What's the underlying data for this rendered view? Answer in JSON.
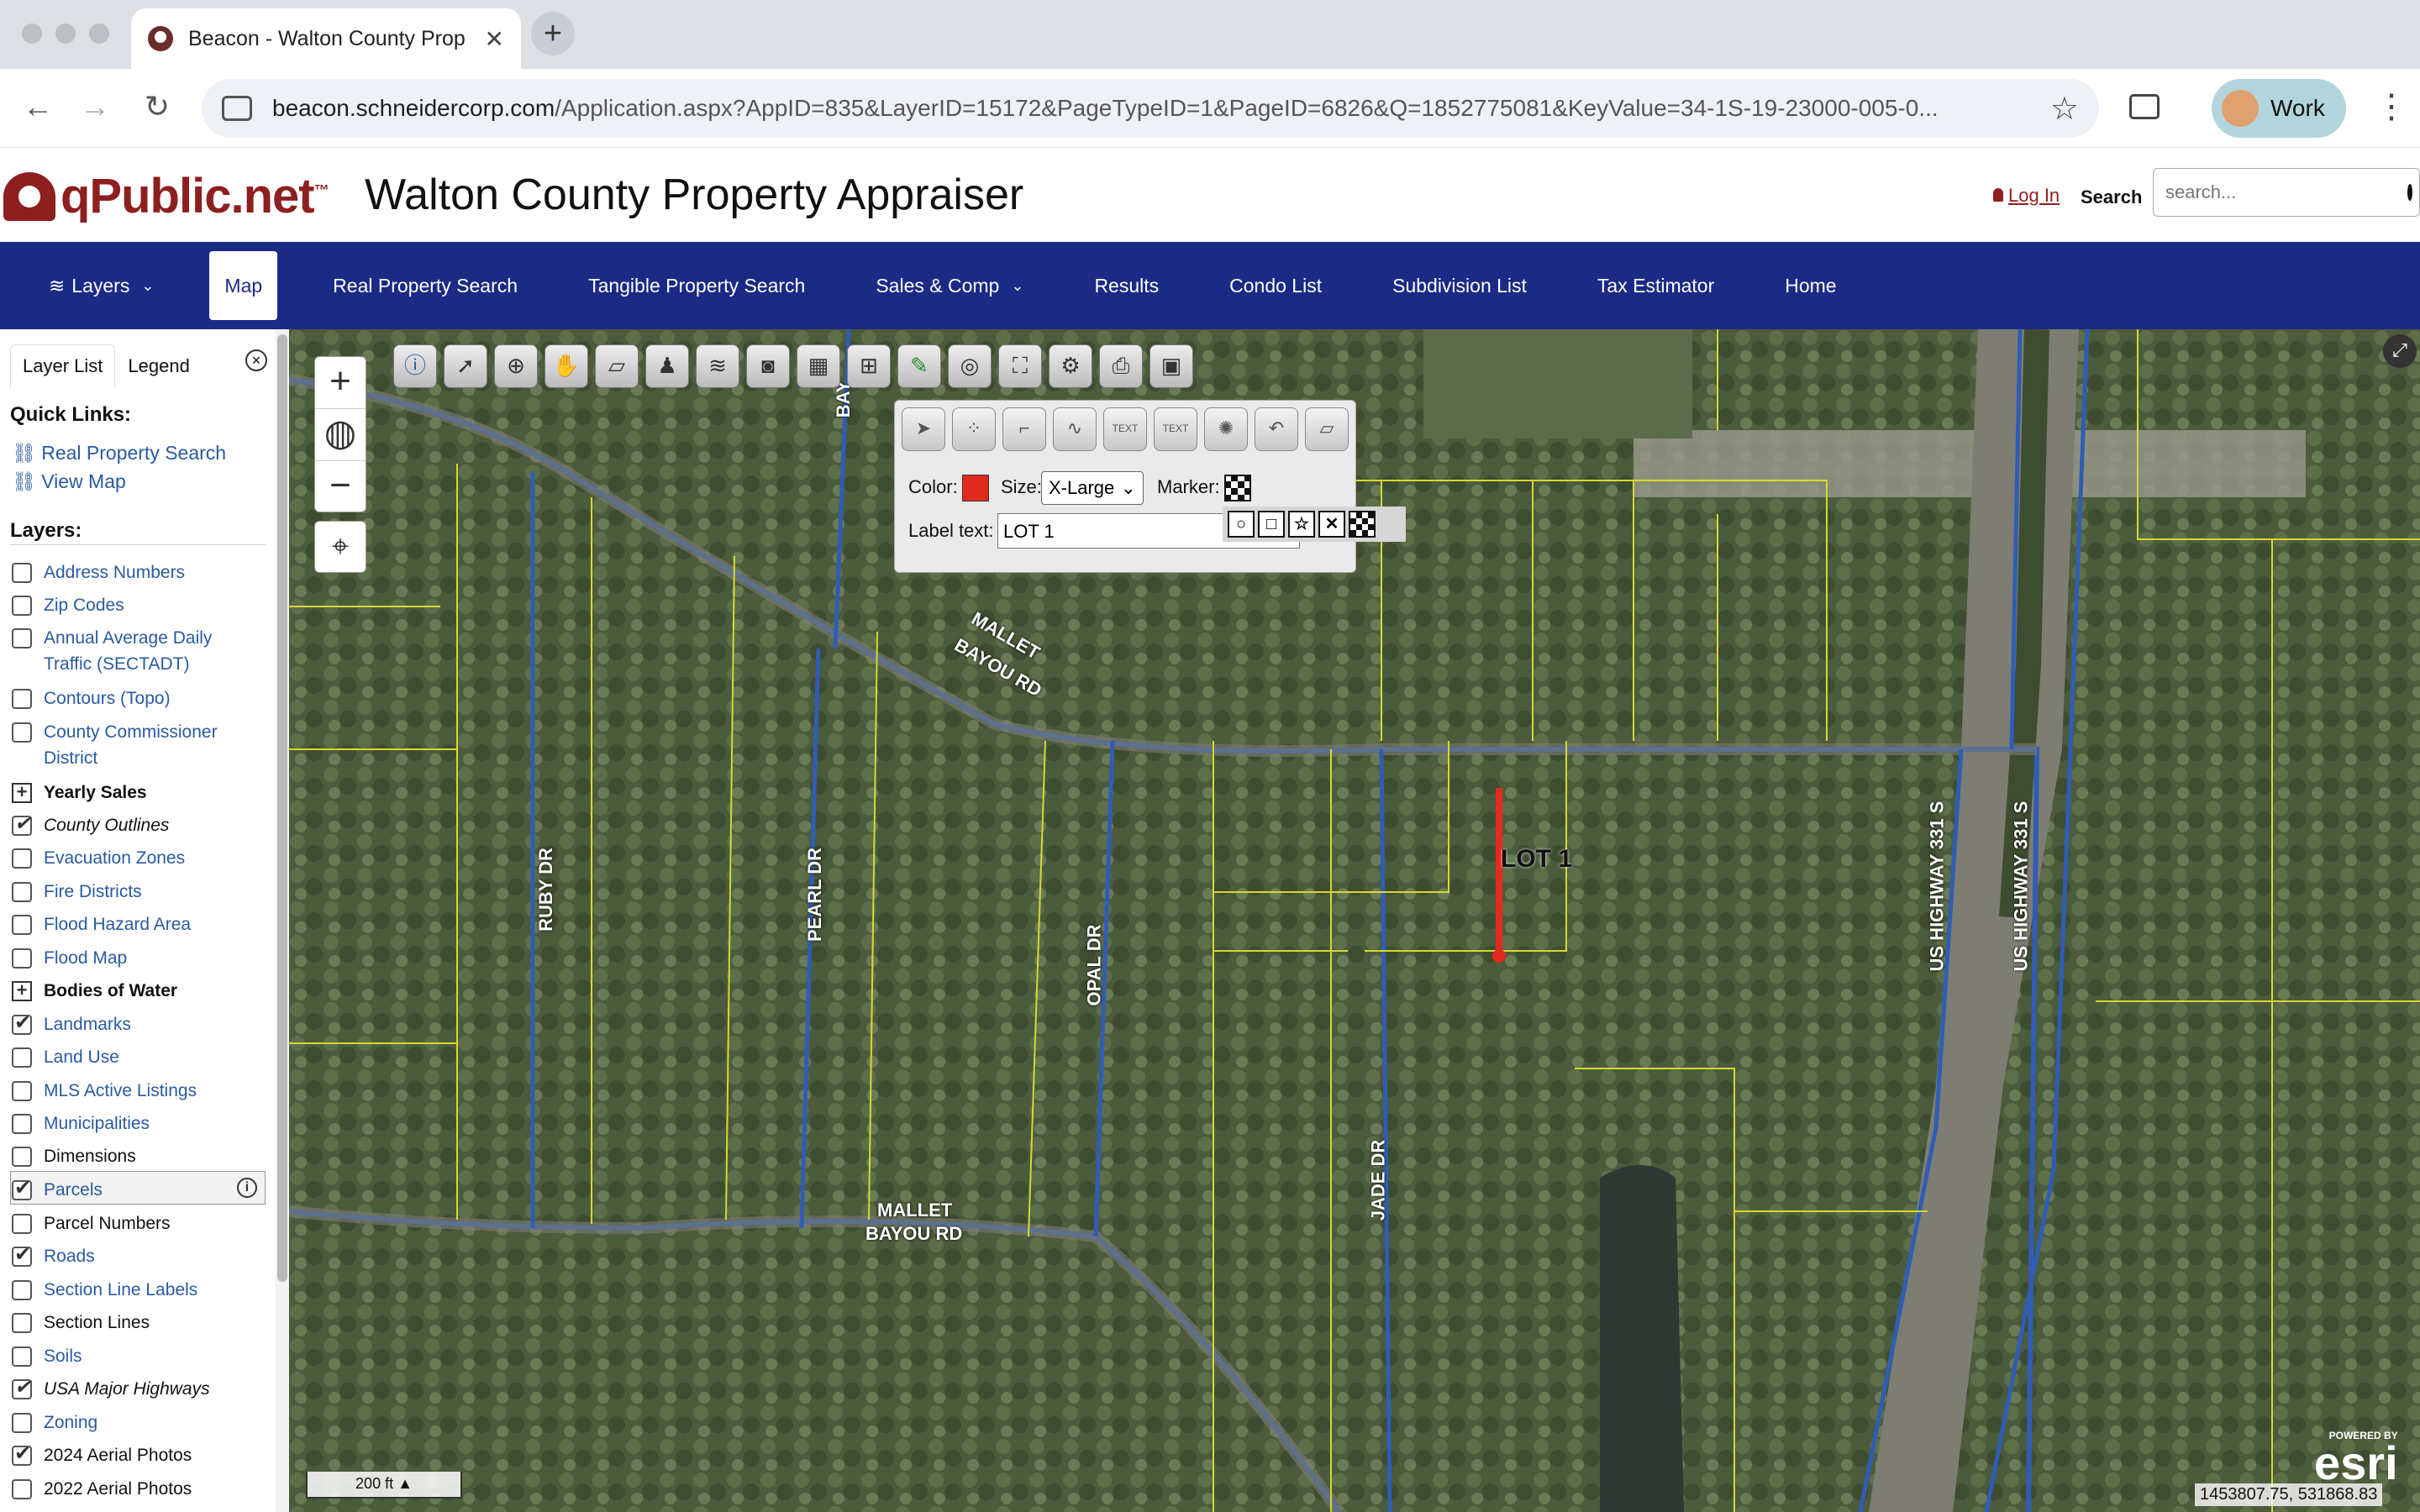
{
  "browser": {
    "tab_title": "Beacon - Walton County Prop",
    "url_host": "beacon.schneidercorp.com",
    "url_path": "/Application.aspx?AppID=835&LayerID=15172&PageTypeID=1&PageID=6826&Q=1852775081&KeyValue=34-1S-19-23000-005-0...",
    "profile_label": "Work"
  },
  "header": {
    "logo_text": "qPublic.net",
    "logo_tm": "™",
    "title": "Walton County Property Appraiser",
    "login": "Log In",
    "search_label": "Search",
    "search_placeholder": "search..."
  },
  "nav": {
    "items": [
      {
        "label": "Layers"
      },
      {
        "label": "Map"
      },
      {
        "label": "Real Property Search"
      },
      {
        "label": "Tangible Property Search"
      },
      {
        "label": "Sales & Comp"
      },
      {
        "label": "Results"
      },
      {
        "label": "Condo List"
      },
      {
        "label": "Subdivision List"
      },
      {
        "label": "Tax Estimator"
      },
      {
        "label": "Home"
      }
    ]
  },
  "leftpanel": {
    "tabs": [
      "Layer List",
      "Legend"
    ],
    "quick_links_heading": "Quick Links:",
    "quick_links": [
      "Real Property Search",
      "View Map"
    ],
    "layers_heading": "Layers:",
    "layers": [
      {
        "label": "Address Numbers",
        "checked": false
      },
      {
        "label": "Zip Codes",
        "checked": false
      },
      {
        "label": "Annual Average Daily Traffic (SECTADT)",
        "checked": false
      },
      {
        "label": "Contours (Topo)",
        "checked": false
      },
      {
        "label": "County Commissioner District",
        "checked": false
      },
      {
        "label": "Yearly Sales",
        "group": true
      },
      {
        "label": "County Outlines",
        "checked": true
      },
      {
        "label": "Evacuation Zones",
        "checked": false
      },
      {
        "label": "Fire Districts",
        "checked": false
      },
      {
        "label": "Flood Hazard Area",
        "checked": false
      },
      {
        "label": "Flood Map",
        "checked": false
      },
      {
        "label": "Bodies of Water",
        "group": true
      },
      {
        "label": "Landmarks",
        "checked": true
      },
      {
        "label": "Land Use",
        "checked": false
      },
      {
        "label": "MLS Active Listings",
        "checked": false
      },
      {
        "label": "Municipalities",
        "checked": false
      },
      {
        "label": "Dimensions",
        "checked": false
      },
      {
        "label": "Parcels",
        "checked": true
      },
      {
        "label": "Parcel Numbers",
        "checked": false
      },
      {
        "label": "Roads",
        "checked": true
      },
      {
        "label": "Section Line Labels",
        "checked": false
      },
      {
        "label": "Section Lines",
        "checked": false
      },
      {
        "label": "Soils",
        "checked": false
      },
      {
        "label": "USA Major Highways",
        "checked": true
      },
      {
        "label": "Zoning",
        "checked": false
      },
      {
        "label": "2024 Aerial Photos",
        "checked": true
      },
      {
        "label": "2022 Aerial Photos",
        "checked": false
      }
    ]
  },
  "draw_panel": {
    "color_label": "Color:",
    "color": "#e42a1f",
    "size_label": "Size:",
    "size_value": "X-Large",
    "marker_label": "Marker:",
    "label_text_label": "Label text:",
    "label_text_value": "LOT  1"
  },
  "map": {
    "annotation": "LOT 1",
    "road_labels": {
      "mallet_top_1": "MALLET",
      "mallet_top_2": "BAYOU RD",
      "mallet_bottom_1": "MALLET",
      "mallet_bottom_2": "BAYOU RD",
      "ruby": "RUBY DR",
      "pearl": "PEARL DR",
      "opal": "OPAL DR",
      "jade": "JADE DR",
      "hwy1": "US HIGHWAY 331 S",
      "hwy2": "US HIGHWAY 331 S",
      "bay": "BAY"
    },
    "scale_label": "200 ft",
    "coordinates": "1453807.75, 531868.83",
    "esri_powered": "POWERED BY",
    "esri": "esri"
  },
  "colors": {
    "accent": "#1b2a85",
    "brand": "#8e1f1f",
    "parcel_line": "#d8d830",
    "road_line": "#2f5db5",
    "drawn_line": "#e42a1f"
  }
}
